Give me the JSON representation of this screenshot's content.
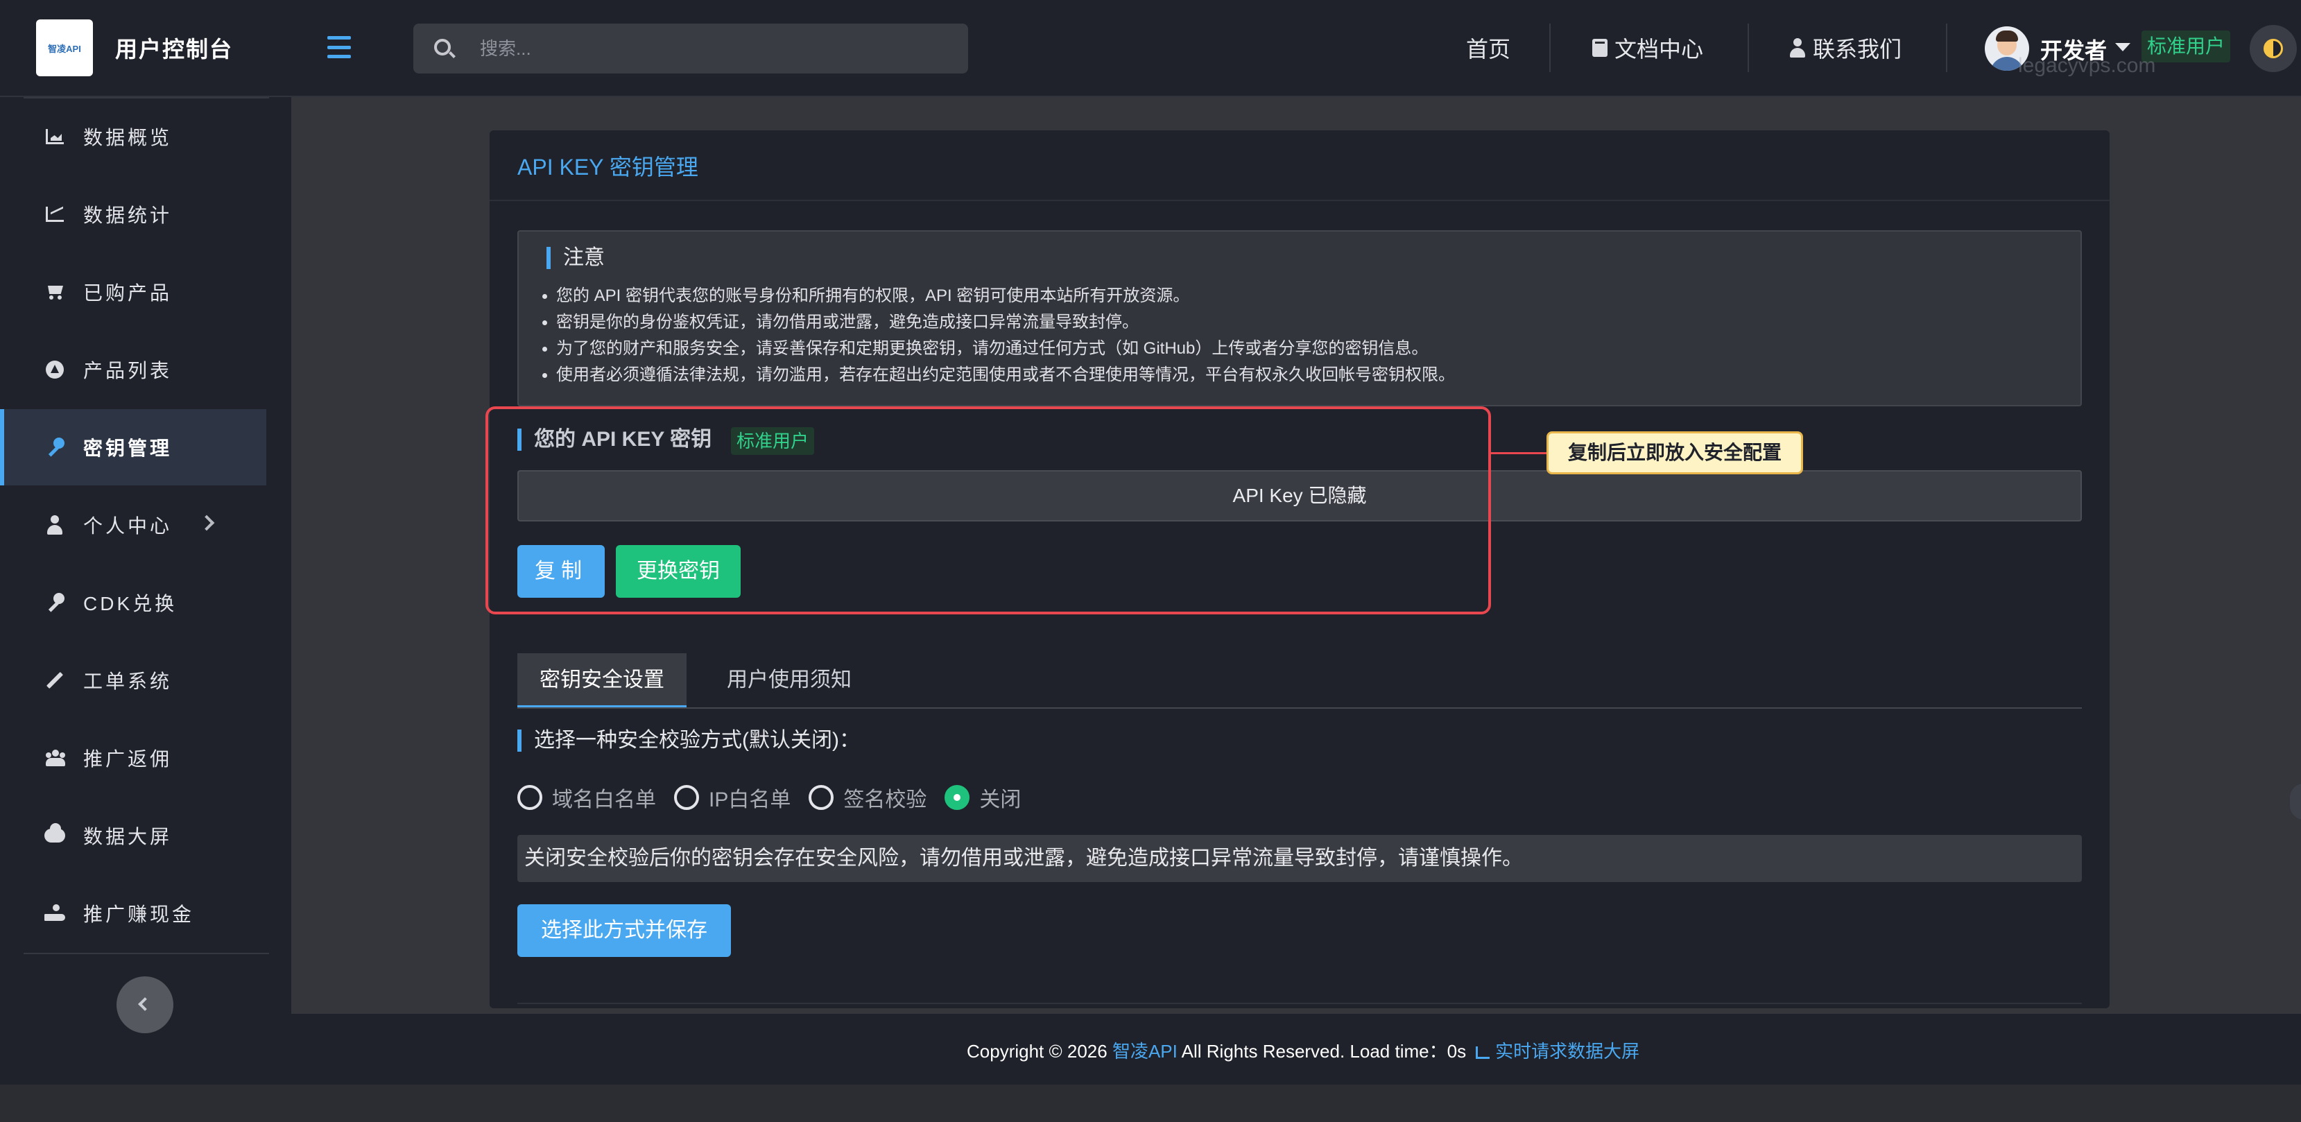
{
  "header": {
    "logo_text": "智凌API",
    "app_title": "用户控制台",
    "search_placeholder": "搜索...",
    "nav": [
      {
        "label": "首页",
        "icon": ""
      },
      {
        "label": "文档中心",
        "icon": "book-icon"
      },
      {
        "label": "联系我们",
        "icon": "person-icon"
      }
    ],
    "username": "开发者",
    "user_badge": "标准用户",
    "watermark": "legacyvps.com"
  },
  "sidebar": {
    "items": [
      {
        "label": "数据概览",
        "icon": "area-chart-icon",
        "active": false
      },
      {
        "label": "数据统计",
        "icon": "line-chart-icon",
        "active": false
      },
      {
        "label": "已购产品",
        "icon": "cart-icon",
        "active": false
      },
      {
        "label": "产品列表",
        "icon": "circle-up-icon",
        "active": false
      },
      {
        "label": "密钥管理",
        "icon": "key-icon",
        "active": true
      },
      {
        "label": "个人中心",
        "icon": "user-icon",
        "active": false,
        "has_submenu": true
      },
      {
        "label": "CDK兑换",
        "icon": "key-icon",
        "active": false
      },
      {
        "label": "工单系统",
        "icon": "pencil-icon",
        "active": false
      },
      {
        "label": "推广返佣",
        "icon": "users-icon",
        "active": false
      },
      {
        "label": "数据大屏",
        "icon": "cloud-icon",
        "active": false
      },
      {
        "label": "推广赚现金",
        "icon": "hand-coin-icon",
        "active": false
      }
    ]
  },
  "main": {
    "panel_title": "API KEY 密钥管理",
    "notice": {
      "title": "注意",
      "items": [
        "您的 API 密钥代表您的账号身份和所拥有的权限，API 密钥可使用本站所有开放资源。",
        "密钥是你的身份鉴权凭证，请勿借用或泄露，避免造成接口异常流量导致封停。",
        "为了您的财产和服务安全，请妥善保存和定期更换密钥，请勿通过任何方式（如 GitHub）上传或者分享您的密钥信息。",
        "使用者必须遵循法律法规，请勿滥用，若存在超出约定范围使用或者不合理使用等情况，平台有权永久收回帐号密钥权限。"
      ]
    },
    "key_section": {
      "title": "您的 API KEY 密钥",
      "badge": "标准用户",
      "key_value": "API Key 已隐藏",
      "copy_label": "复制",
      "change_label": "更换密钥",
      "callout": "复制后立即放入安全配置"
    },
    "tabs": [
      {
        "label": "密钥安全设置",
        "active": true
      },
      {
        "label": "用户使用须知",
        "active": false
      }
    ],
    "security": {
      "title": "选择一种安全校验方式(默认关闭)：",
      "options": [
        {
          "label": "域名白名单",
          "checked": false
        },
        {
          "label": "IP白名单",
          "checked": false
        },
        {
          "label": "签名校验",
          "checked": false
        },
        {
          "label": "关闭",
          "checked": true
        }
      ],
      "warning": "关闭安全校验后你的密钥会存在安全风险，请勿借用或泄露，避免造成接口异常流量导致封停，请谨慎操作。",
      "save_label": "选择此方式并保存"
    }
  },
  "footer": {
    "prefix": "Copyright © 2026 ",
    "brand": "智凌API",
    "middle": " All Rights Reserved. Load time：0s",
    "screen_link": "实时请求数据大屏"
  },
  "colors": {
    "accent": "#4aa8f0",
    "success": "#1fc27c",
    "danger": "#e8474f",
    "background": "#1f222a"
  }
}
